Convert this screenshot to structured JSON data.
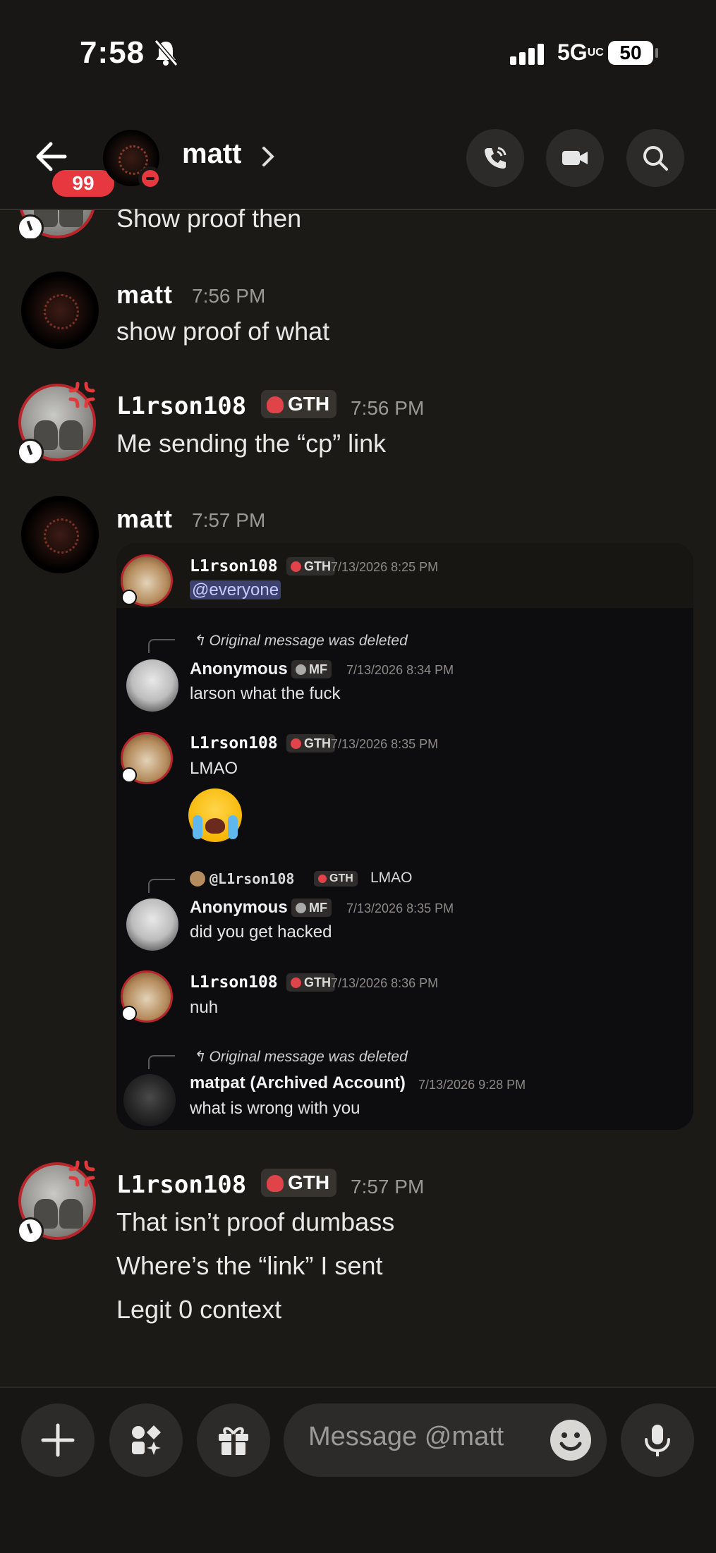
{
  "status_bar": {
    "time": "7:58",
    "network": "5G",
    "network_sup": "UC",
    "battery": "50"
  },
  "header": {
    "unread_count": "99",
    "title": "matt"
  },
  "messages": {
    "m0": {
      "text": "Show proof then"
    },
    "m1": {
      "author": "matt",
      "time": "7:56 PM",
      "text": "show proof of what"
    },
    "m2": {
      "author": "L1rson108",
      "tag": "GTH",
      "time": "7:56 PM",
      "text": "Me sending the “cp” link"
    },
    "m3": {
      "author": "matt",
      "time": "7:57 PM"
    },
    "m4": {
      "author": "L1rson108",
      "tag": "GTH",
      "time": "7:57 PM",
      "lines": [
        "That isn’t proof dumbass",
        "Where’s the “link” I sent",
        "Legit 0 context"
      ]
    }
  },
  "embed": {
    "e1": {
      "author": "L1rson108",
      "tag": "GTH",
      "time": "7/13/2026 8:25 PM",
      "text": "@everyone"
    },
    "e2": {
      "reply": "Original message was deleted",
      "author": "Anonymous",
      "tag": "MF",
      "time": "7/13/2026 8:34 PM",
      "text": "larson what the fuck"
    },
    "e3": {
      "author": "L1rson108",
      "tag": "GTH",
      "time": "7/13/2026 8:35 PM",
      "text": "LMAO",
      "emoji": "loudly-crying-face"
    },
    "e4": {
      "reply_author": "@L1rson108",
      "reply_tag": "GTH",
      "reply_text": "LMAO",
      "author": "Anonymous",
      "tag": "MF",
      "time": "7/13/2026 8:35 PM",
      "text": "did you get hacked"
    },
    "e5": {
      "author": "L1rson108",
      "tag": "GTH",
      "time": "7/13/2026 8:36 PM",
      "text": "nuh"
    },
    "e6": {
      "reply": "Original message was deleted",
      "author": "matpat (Archived Account)",
      "time": "7/13/2026 9:28 PM",
      "text": "what is wrong with you"
    }
  },
  "composer": {
    "placeholder": "Message @matt"
  },
  "icons": [
    "back-arrow-icon",
    "bell-slash-icon",
    "phone-icon",
    "video-camera-icon",
    "search-icon",
    "plus-icon",
    "apps-icon",
    "gift-icon",
    "emoji-icon",
    "microphone-icon",
    "reply-arrow-icon"
  ],
  "colors": {
    "background": "#1c1a17",
    "badge_red": "#e6383e",
    "mention": "#3d416e",
    "tag_skull": "#e0444a"
  }
}
